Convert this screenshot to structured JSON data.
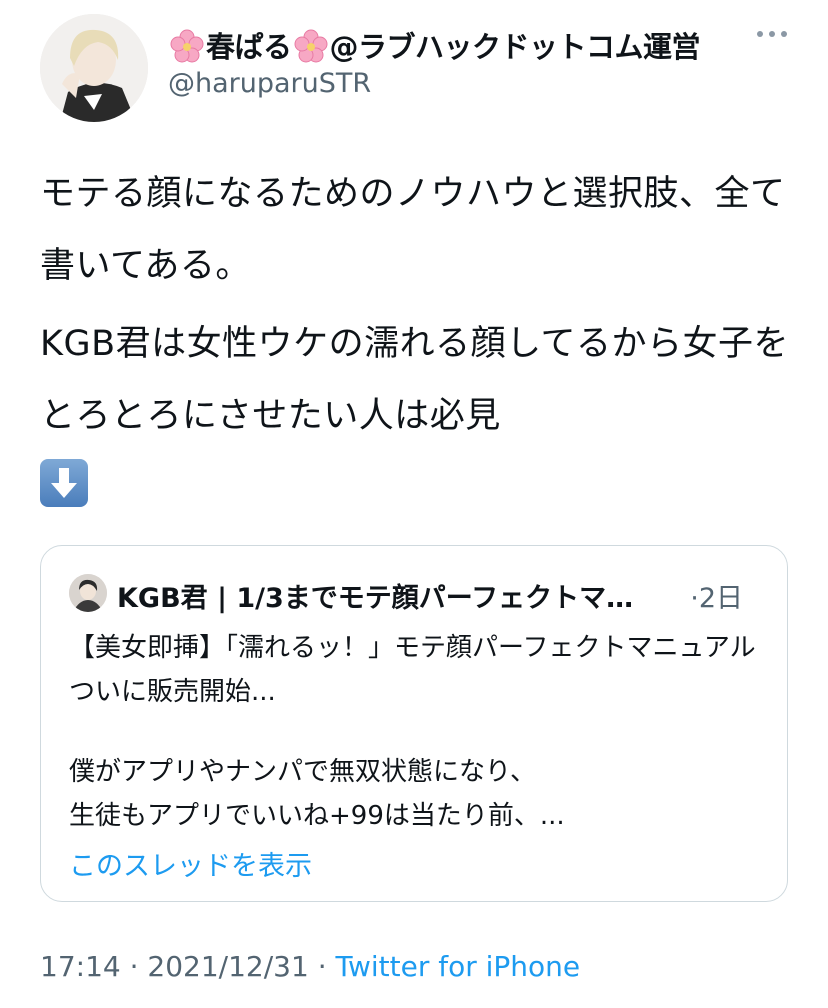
{
  "author": {
    "display_name": "春ぱる",
    "display_name_suffix": "@ラブハックドットコム運営",
    "handle": "@haruparuSTR"
  },
  "tweet": {
    "paragraph1": "モテる顔になるためのノウハウと選択肢、全て書いてある。",
    "paragraph2": "KGB君は女性ウケの濡れる顔してるから女子をとろとろにさせたい人は必見"
  },
  "quote": {
    "author_name": "KGB君 | 1/3までモテ顔パーフェクトマ…",
    "time": "·2日",
    "line1": "【美女即挿】「濡れるッ！」モテ顔パーフェクトマニュアルついに販売開始...",
    "line2": "僕がアプリやナンパで無双状態になり、",
    "line3": "生徒もアプリでいいね+99は当たり前、...",
    "thread_link": "このスレッドを表示"
  },
  "meta": {
    "time": "17:14",
    "sep1": " · ",
    "date": "2021/12/31",
    "sep2": " · ",
    "source": "Twitter for iPhone"
  },
  "icons": {
    "flower": "cherry-blossom-icon",
    "more": "more-icon",
    "arrow": "down-arrow-emoji-icon"
  },
  "colors": {
    "text": "#0f1419",
    "secondary": "#536471",
    "link": "#1d9bf0",
    "border": "#cfd9de"
  }
}
